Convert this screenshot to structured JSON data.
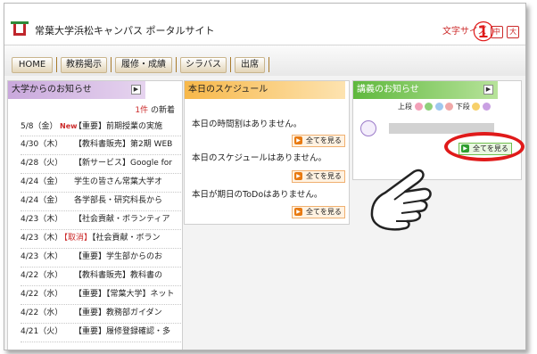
{
  "header": {
    "site_title": "常葉大学浜松キャンパス ポータルサイト",
    "font_size_label": "文字サイズ",
    "font_size_buttons": [
      "中",
      "大"
    ]
  },
  "nav": {
    "items": [
      "HOME",
      "教務掲示",
      "履修・成績",
      "シラバス",
      "出席"
    ]
  },
  "annotation": {
    "number": "①"
  },
  "panels": {
    "news": {
      "title": "大学からのお知らせ",
      "count_number": "1件",
      "count_suffix": "の新着",
      "rows": [
        {
          "date": "5/8（金）",
          "new": "New",
          "prefix": "",
          "text": "【重要】前期授業の実施"
        },
        {
          "date": "4/30（木）",
          "new": "",
          "prefix": "",
          "text": "【教科書販売】第2期 WEB"
        },
        {
          "date": "4/28（火）",
          "new": "",
          "prefix": "",
          "text": "【新サービス】Google for"
        },
        {
          "date": "4/24（金）",
          "new": "",
          "prefix": "",
          "text": "学生の皆さん常葉大学オ"
        },
        {
          "date": "4/24（金）",
          "new": "",
          "prefix": "",
          "text": "各学部長・研究科長から"
        },
        {
          "date": "4/23（木）",
          "new": "",
          "prefix": "",
          "text": "【社会貢献・ボランティア"
        },
        {
          "date": "4/23（木）",
          "new": "",
          "prefix": "【取消】",
          "text": "【社会貢献・ボラン"
        },
        {
          "date": "4/23（木）",
          "new": "",
          "prefix": "",
          "text": "【重要】学生部からのお"
        },
        {
          "date": "4/22（水）",
          "new": "",
          "prefix": "",
          "text": "【教科書販売】教科書の"
        },
        {
          "date": "4/22（水）",
          "new": "",
          "prefix": "",
          "text": "【重要】【常葉大学】ネット"
        },
        {
          "date": "4/22（水）",
          "new": "",
          "prefix": "",
          "text": "【重要】教務部ガイダン"
        },
        {
          "date": "4/21（火）",
          "new": "",
          "prefix": "",
          "text": "【重要】履修登録確認・多"
        }
      ]
    },
    "schedule": {
      "title": "本日のスケジュール",
      "items": [
        {
          "text": "本日の時間割はありません。",
          "button": "全てを見る"
        },
        {
          "text": "本日のスケジュールはありません。",
          "button": "全てを見る"
        },
        {
          "text": "本日が期日のToDoはありません。",
          "button": "全てを見る"
        }
      ]
    },
    "lecture": {
      "title": "講義のお知らせ",
      "order_top": "上段",
      "order_bottom": "下段",
      "button": "全てを見る"
    }
  },
  "colors": {
    "accent_red": "#e01a1a",
    "news_header": "#c9a8dc",
    "schedule_header": "#f7b84a",
    "lecture_header": "#5fb83d",
    "nav_separator": "#a87a2a"
  }
}
